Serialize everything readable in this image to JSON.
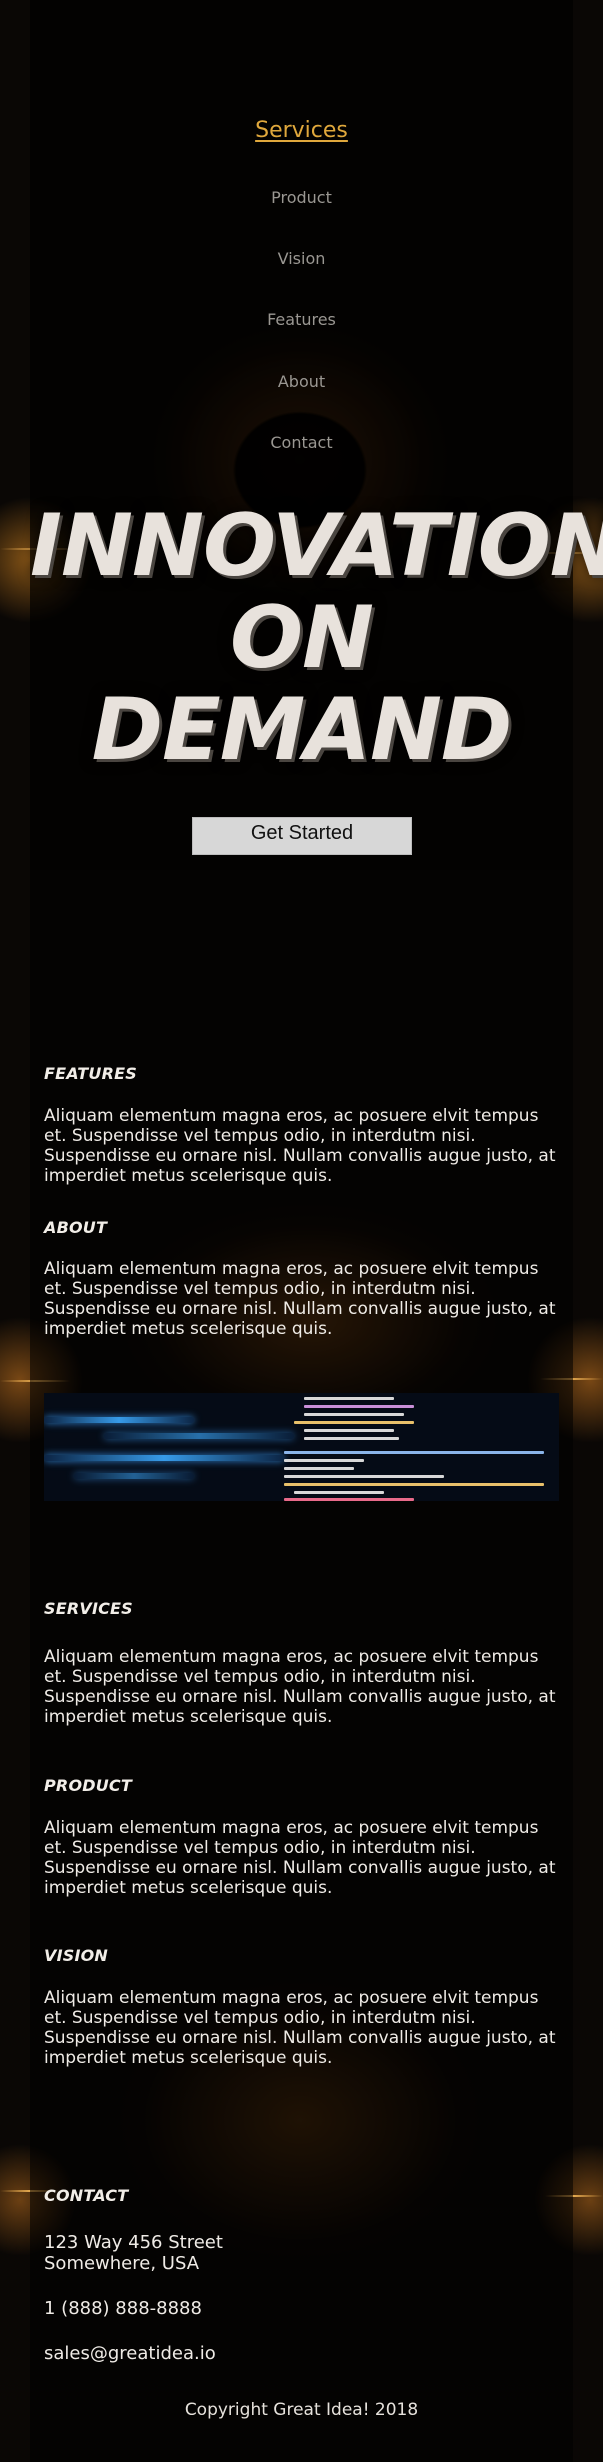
{
  "nav": {
    "items": [
      {
        "label": "Services",
        "active": true
      },
      {
        "label": "Product",
        "active": false
      },
      {
        "label": "Vision",
        "active": false
      },
      {
        "label": "Features",
        "active": false
      },
      {
        "label": "About",
        "active": false
      },
      {
        "label": "Contact",
        "active": false
      }
    ]
  },
  "hero": {
    "title_lines": [
      "INNOVATION",
      "ON",
      "DEMAND"
    ],
    "cta_label": "Get Started"
  },
  "sections": [
    {
      "heading": "FEATURES",
      "body": "Aliquam elementum magna eros, ac posuere elvit tempus et. Suspendisse vel tempus odio, in interdutm nisi. Suspendisse eu ornare nisl. Nullam convallis augue justo, at imperdiet metus scelerisque quis."
    },
    {
      "heading": "ABOUT",
      "body": "Aliquam elementum magna eros, ac posuere elvit tempus et. Suspendisse vel tempus odio, in interdutm nisi. Suspendisse eu ornare nisl. Nullam convallis augue justo, at imperdiet metus scelerisque quis."
    },
    {
      "heading": "SERVICES",
      "body": "Aliquam elementum magna eros, ac posuere elvit tempus et. Suspendisse vel tempus odio, in interdutm nisi. Suspendisse eu ornare nisl. Nullam convallis augue justo, at imperdiet metus scelerisque quis."
    },
    {
      "heading": "PRODUCT",
      "body": "Aliquam elementum magna eros, ac posuere elvit tempus et. Suspendisse vel tempus odio, in interdutm nisi. Suspendisse eu ornare nisl. Nullam convallis augue justo, at imperdiet metus scelerisque quis."
    },
    {
      "heading": "VISION",
      "body": "Aliquam elementum magna eros, ac posuere elvit tempus et. Suspendisse vel tempus odio, in interdutm nisi. Suspendisse eu ornare nisl. Nullam convallis augue justo, at imperdiet metus scelerisque quis."
    }
  ],
  "contact": {
    "heading": "CONTACT",
    "address_line1": "123 Way 456 Street",
    "address_line2": "Somewhere, USA",
    "phone": "1 (888) 888-8888",
    "email": "sales@greatidea.io"
  },
  "footer": {
    "copyright": "Copyright Great Idea! 2018"
  },
  "colors": {
    "accent": "#e0a83c",
    "text": "#efebe6",
    "nav_text": "#9a9792"
  }
}
